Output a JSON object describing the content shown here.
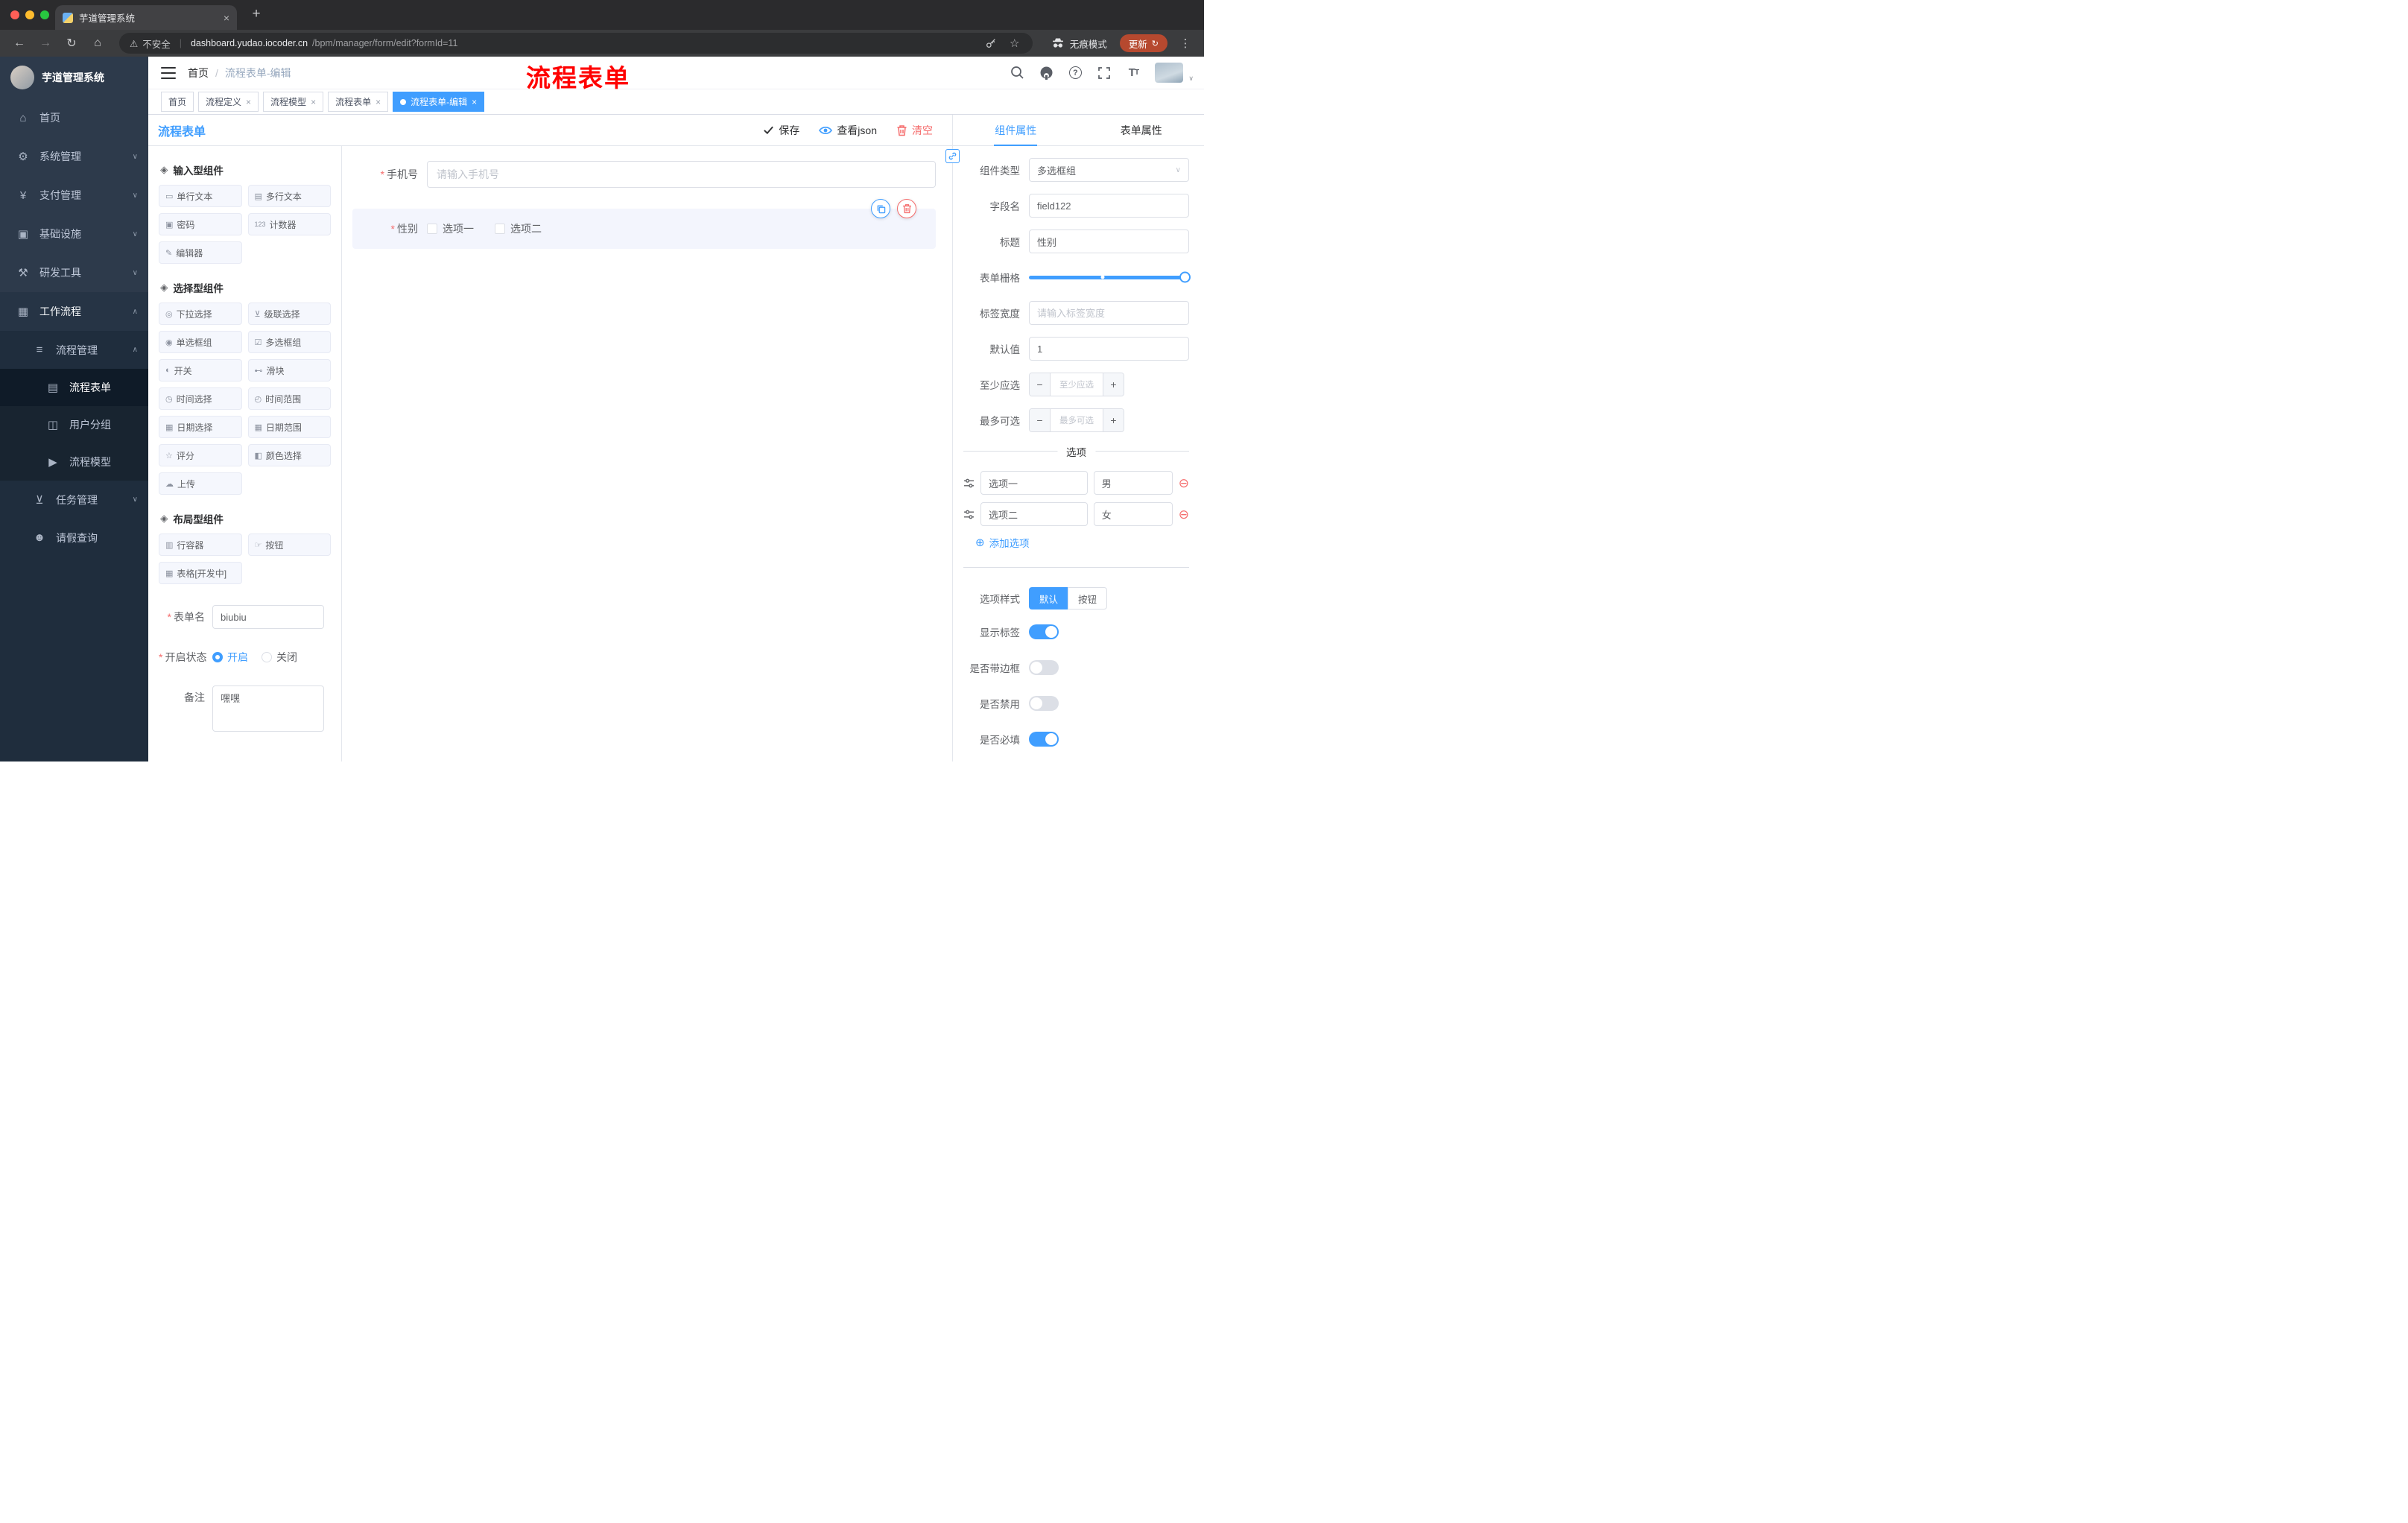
{
  "ui": {
    "close": "×",
    "new_tab": "+",
    "back": "←",
    "forward": "→",
    "reload": "↻",
    "home": "⌂",
    "warning": "⚠",
    "star": "☆",
    "dots": "⋮",
    "slash": "/",
    "caret_up": "∧",
    "caret_down": "∨",
    "select_caret": "∨",
    "minus": "−",
    "plus": "+",
    "remove": "⊖",
    "add": "⊕"
  },
  "browser": {
    "tab_title": "芋道管理系统",
    "security_label": "不安全",
    "url_domain": "dashboard.yudao.iocoder.cn",
    "url_path": "/bpm/manager/form/edit?formId=11",
    "incognito_label": "无痕模式",
    "update_label": "更新"
  },
  "sidebar": {
    "brand": "芋道管理系统",
    "items": [
      {
        "icon": "⌂",
        "label": "首页"
      },
      {
        "icon": "⚙",
        "label": "系统管理"
      },
      {
        "icon": "¥",
        "label": "支付管理"
      },
      {
        "icon": "▣",
        "label": "基础设施"
      },
      {
        "icon": "⚒",
        "label": "研发工具"
      },
      {
        "icon": "▦",
        "label": "工作流程"
      },
      {
        "icon": "≡",
        "label": "流程管理"
      },
      {
        "icon": "▤",
        "label": "流程表单"
      },
      {
        "icon": "◫",
        "label": "用户分组"
      },
      {
        "icon": "▶",
        "label": "流程模型"
      },
      {
        "icon": "⊻",
        "label": "任务管理"
      },
      {
        "icon": "☻",
        "label": "请假查询"
      }
    ]
  },
  "header": {
    "breadcrumb_home": "首页",
    "breadcrumb_current": "流程表单-编辑",
    "annotation": "流程表单"
  },
  "tags": {
    "items": [
      {
        "label": "首页"
      },
      {
        "label": "流程定义"
      },
      {
        "label": "流程模型"
      },
      {
        "label": "流程表单"
      },
      {
        "label": "流程表单-编辑"
      }
    ]
  },
  "designer": {
    "title": "流程表单",
    "save": "保存",
    "view_json": "查看json",
    "clear": "清空"
  },
  "palette": {
    "groups": [
      {
        "title": "输入型组件",
        "items": [
          {
            "icon": "▭",
            "label": "单行文本"
          },
          {
            "icon": "▤",
            "label": "多行文本"
          },
          {
            "icon": "▣",
            "label": "密码"
          },
          {
            "icon": "123",
            "label": "计数器"
          },
          {
            "icon": "✎",
            "label": "编辑器"
          }
        ]
      },
      {
        "title": "选择型组件",
        "items": [
          {
            "icon": "◎",
            "label": "下拉选择"
          },
          {
            "icon": "⊻",
            "label": "级联选择"
          },
          {
            "icon": "◉",
            "label": "单选框组"
          },
          {
            "icon": "☑",
            "label": "多选框组"
          },
          {
            "icon": "◐",
            "label": "开关"
          },
          {
            "icon": "⊷",
            "label": "滑块"
          },
          {
            "icon": "◷",
            "label": "时间选择"
          },
          {
            "icon": "◴",
            "label": "时间范围"
          },
          {
            "icon": "▦",
            "label": "日期选择"
          },
          {
            "icon": "▦",
            "label": "日期范围"
          },
          {
            "icon": "☆",
            "label": "评分"
          },
          {
            "icon": "◧",
            "label": "颜色选择"
          },
          {
            "icon": "☁",
            "label": "上传"
          }
        ]
      },
      {
        "title": "布局型组件",
        "items": [
          {
            "icon": "▥",
            "label": "行容器"
          },
          {
            "icon": "☞",
            "label": "按钮"
          },
          {
            "icon": "▦",
            "label": "表格[开发中]"
          }
        ]
      }
    ]
  },
  "form": {
    "name_label": "表单名",
    "name_value": "biubiu",
    "status_label": "开启状态",
    "status_on": "开启",
    "status_off": "关闭",
    "remark_label": "备注",
    "remark_value": "嘿嘿"
  },
  "canvas": {
    "phone_label": "手机号",
    "phone_placeholder": "请输入手机号",
    "gender_label": "性别",
    "gender_opt1": "选项一",
    "gender_opt2": "选项二"
  },
  "props": {
    "tab_component": "组件属性",
    "tab_form": "表单属性",
    "component_type_label": "组件类型",
    "component_type_value": "多选框组",
    "field_name_label": "字段名",
    "field_name_value": "field122",
    "title_label": "标题",
    "title_value": "性别",
    "grid_label": "表单栅格",
    "label_width_label": "标签宽度",
    "label_width_placeholder": "请输入标签宽度",
    "default_label": "默认值",
    "default_value": "1",
    "min_label": "至少应选",
    "min_placeholder": "至少应选",
    "max_label": "最多可选",
    "max_placeholder": "最多可选",
    "options_title": "选项",
    "options": [
      {
        "name": "选项一",
        "value": "男"
      },
      {
        "name": "选项二",
        "value": "女"
      }
    ],
    "add_option": "添加选项",
    "style_label": "选项样式",
    "style_default": "默认",
    "style_button": "按钮",
    "toggle_show_label": "显示标签",
    "toggle_border": "是否带边框",
    "toggle_disabled": "是否禁用",
    "toggle_required": "是否必填"
  }
}
